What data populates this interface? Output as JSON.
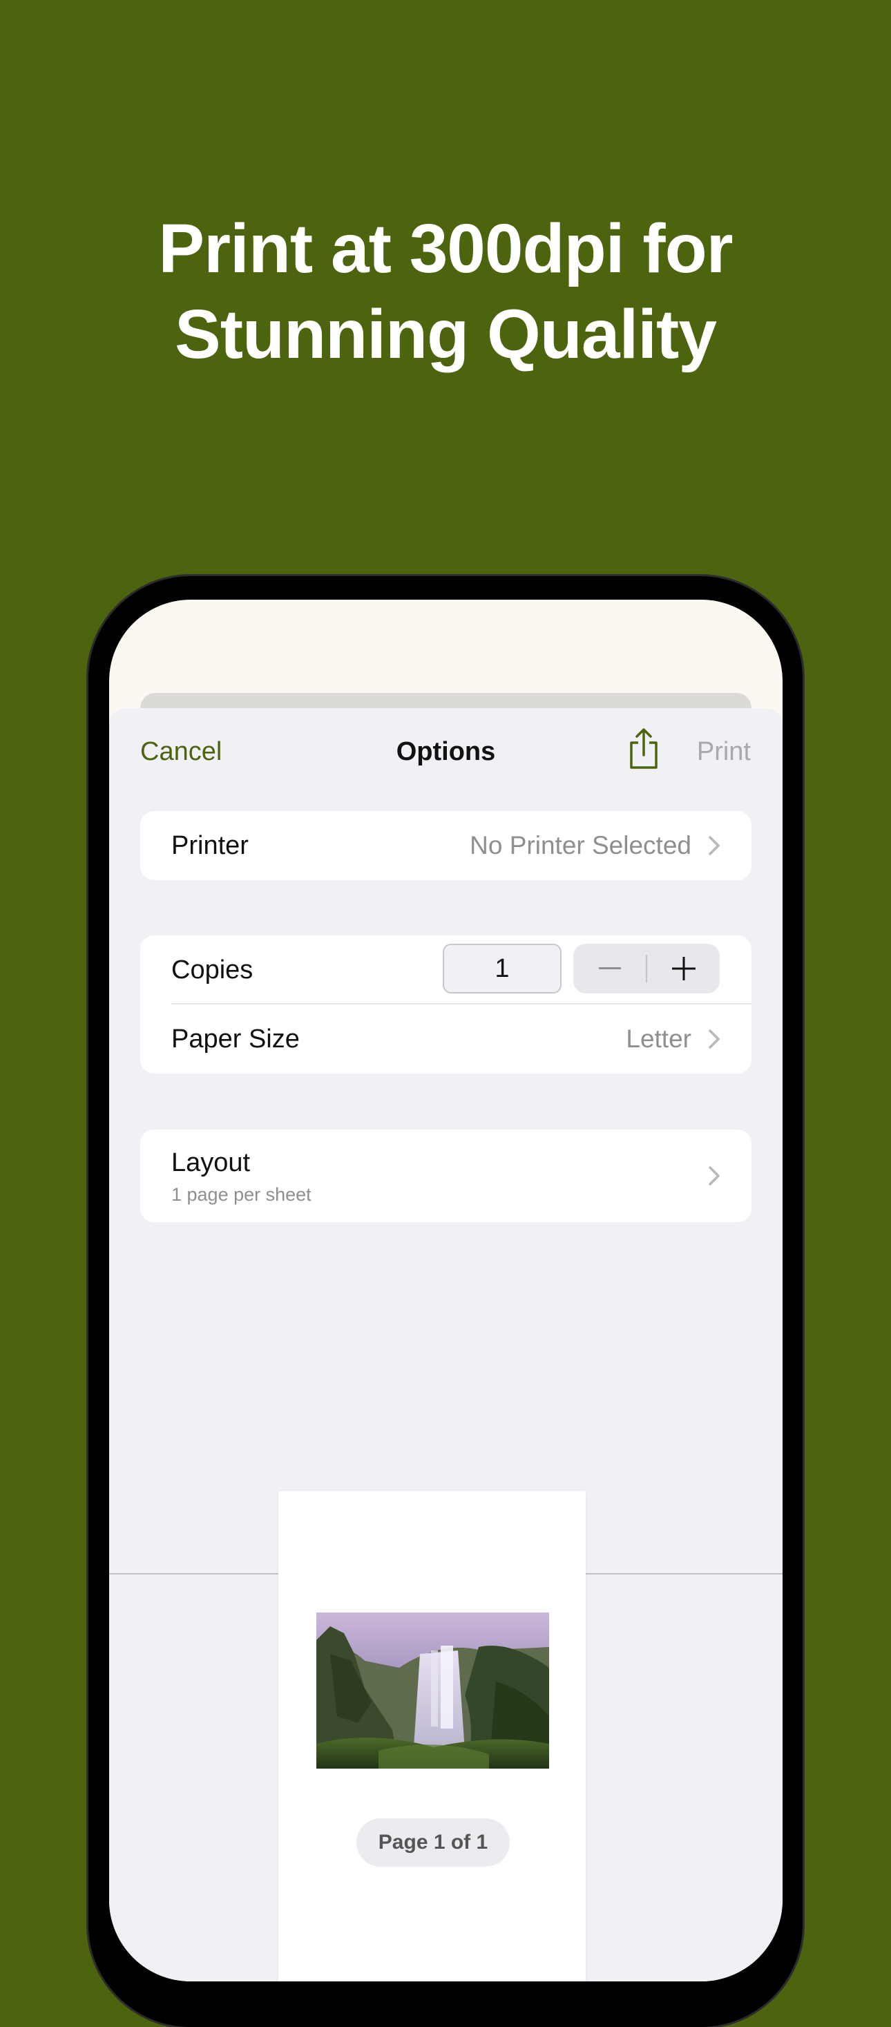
{
  "headline": {
    "line1": "Print at 300dpi for",
    "line2": "Stunning Quality"
  },
  "colors": {
    "background": "#4c640e",
    "accent": "#4c640e",
    "sheet": "#f1f0f5"
  },
  "nav": {
    "cancel_label": "Cancel",
    "title": "Options",
    "share_icon": "share-icon",
    "print_label": "Print"
  },
  "printer_row": {
    "label": "Printer",
    "value": "No Printer Selected"
  },
  "copies_row": {
    "label": "Copies",
    "value": "1",
    "decrement_icon": "minus-icon",
    "increment_icon": "plus-icon"
  },
  "paper_size_row": {
    "label": "Paper Size",
    "value": "Letter"
  },
  "layout_row": {
    "label": "Layout",
    "subtitle": "1 page per sheet"
  },
  "preview": {
    "page_indicator": "Page 1 of 1"
  }
}
